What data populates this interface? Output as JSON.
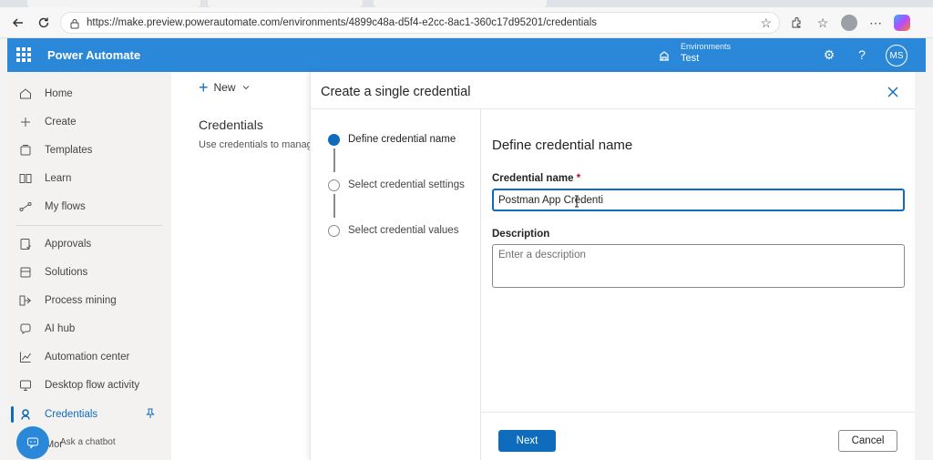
{
  "browser": {
    "url": "https://make.preview.powerautomate.com/environments/4899c48a-d5f4-e2cc-8ac1-360c17d95201/credentials"
  },
  "header": {
    "app_title": "Power Automate",
    "environment_label": "Environments",
    "environment_value": "Test",
    "avatar_initials": "MS"
  },
  "sidebar": {
    "items": [
      {
        "label": "Home",
        "icon": "home-icon"
      },
      {
        "label": "Create",
        "icon": "plus-icon"
      },
      {
        "label": "Templates",
        "icon": "templates-icon"
      },
      {
        "label": "Learn",
        "icon": "book-icon"
      },
      {
        "label": "My flows",
        "icon": "flows-icon"
      },
      {
        "label": "Approvals",
        "icon": "approvals-icon"
      },
      {
        "label": "Solutions",
        "icon": "solutions-icon"
      },
      {
        "label": "Process mining",
        "icon": "process-mining-icon"
      },
      {
        "label": "AI hub",
        "icon": "ai-hub-icon"
      },
      {
        "label": "Automation center",
        "icon": "chart-icon"
      },
      {
        "label": "Desktop flow activity",
        "icon": "desktop-icon"
      },
      {
        "label": "Credentials",
        "icon": "credentials-icon"
      }
    ],
    "more_label": "Mor",
    "chatbot_label": "Ask a chatbot"
  },
  "main": {
    "new_label": "New",
    "title": "Credentials",
    "description": "Use credentials to manag"
  },
  "panel": {
    "title": "Create a single credential",
    "steps": [
      {
        "label": "Define credential name",
        "active": true
      },
      {
        "label": "Select credential settings",
        "active": false
      },
      {
        "label": "Select credential values",
        "active": false
      }
    ],
    "form_heading": "Define credential name",
    "name_label": "Credential name",
    "required_marker": "*",
    "name_value": "Postman App Credenti",
    "description_label": "Description",
    "description_placeholder": "Enter a description",
    "next_label": "Next",
    "cancel_label": "Cancel"
  },
  "colors": {
    "accent": "#0f6cbd",
    "header": "#2b88d8"
  }
}
